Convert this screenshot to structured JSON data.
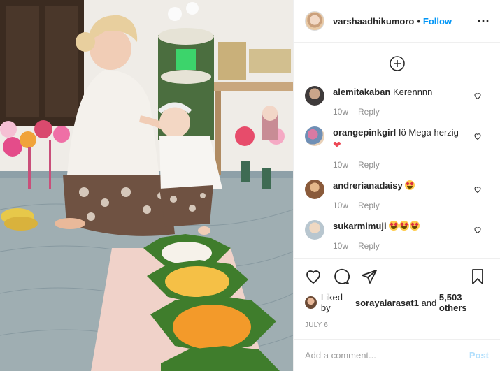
{
  "post": {
    "image_alt": "Mother and baby at a ceremony with colorful decorations and rice offerings",
    "header": {
      "username": "varshaadhikumoro",
      "separator": "•",
      "follow_label": "Follow",
      "more_icon": "more-horizontal-icon"
    },
    "load_more_icon": "plus-circle-icon",
    "comments": [
      {
        "username": "alemitakaban",
        "text": "Kerennnn",
        "age": "10w",
        "reply_label": "Reply"
      },
      {
        "username": "orangepinkgirl",
        "text": "Iö Mega herzig",
        "emoji": "red-heart",
        "age": "10w",
        "reply_label": "Reply"
      },
      {
        "username": "andrerianadaisy",
        "emoji_count": 1,
        "age": "10w",
        "reply_label": "Reply"
      },
      {
        "username": "sukarmimuji",
        "emoji_count": 3,
        "age": "10w",
        "reply_label": "Reply"
      }
    ],
    "actions": {
      "like_icon": "heart-icon",
      "comment_icon": "comment-icon",
      "share_icon": "share-icon",
      "save_icon": "bookmark-icon"
    },
    "likes": {
      "prefix": "Liked by",
      "user": "sorayalarasat1",
      "middle": "and",
      "count": "5,503 others"
    },
    "date": "JULY 6",
    "add_comment": {
      "placeholder": "Add a comment...",
      "post_label": "Post"
    },
    "colors": {
      "link_blue": "#0095f6",
      "post_disabled": "#b2dffc",
      "meta_gray": "#8e8e8e",
      "border": "#efefef"
    }
  }
}
